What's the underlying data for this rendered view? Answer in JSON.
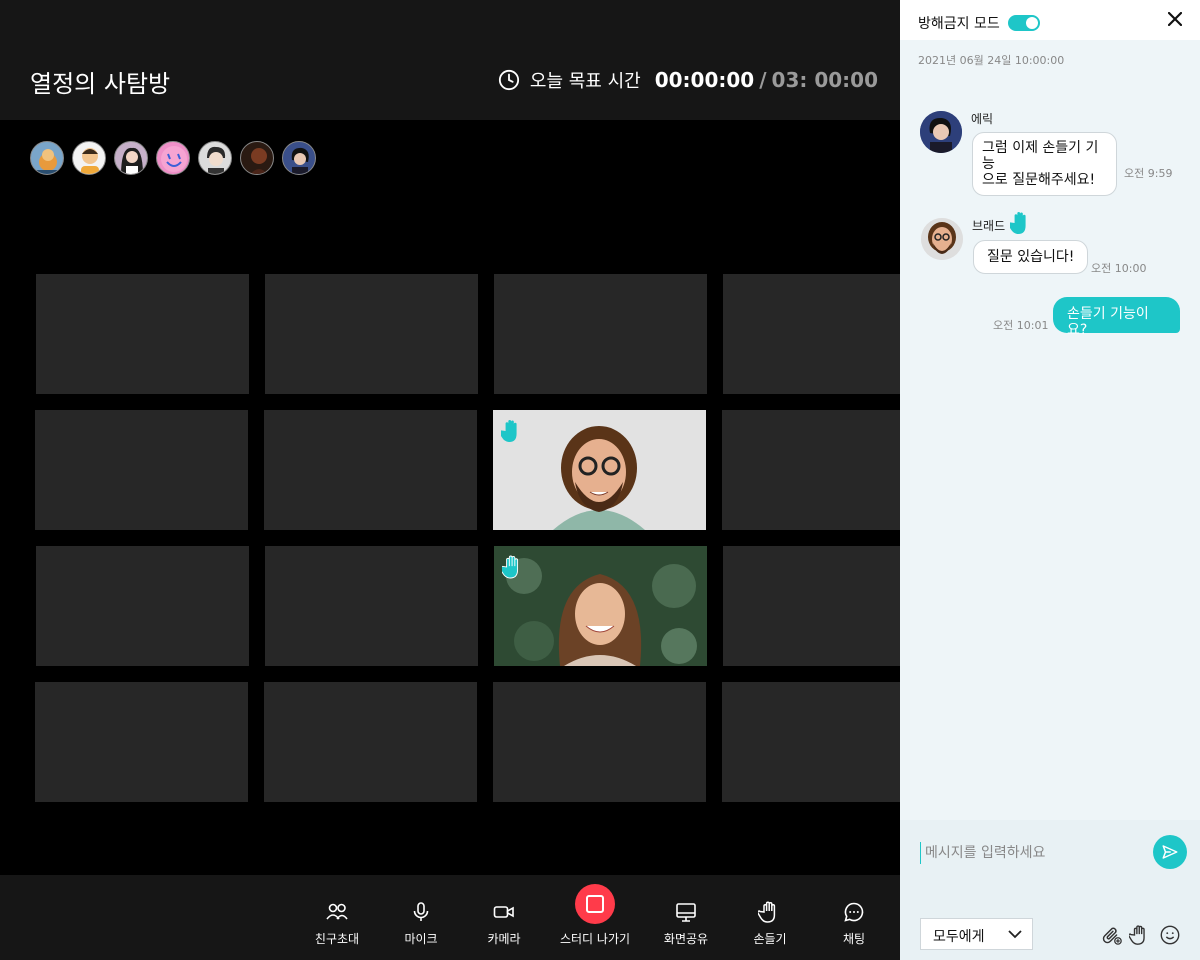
{
  "room": {
    "title": "열정의 사탐방"
  },
  "timer": {
    "label": "오늘 목표 시간",
    "current": "00:00:00",
    "separator": "/",
    "goal": "03: 00:00"
  },
  "participants": [
    {
      "avatar": "cartoon-cat-avatar",
      "color": "#7aa5c9"
    },
    {
      "avatar": "kid-avatar",
      "color": "#e9b24a"
    },
    {
      "avatar": "woman-avatar",
      "color": "#c6b0c9"
    },
    {
      "avatar": "smiley-avatar",
      "color": "#ef90c8"
    },
    {
      "avatar": "man-avatar",
      "color": "#bdbdbd"
    },
    {
      "avatar": "dark-portrait-avatar",
      "color": "#5a3a2a"
    },
    {
      "avatar": "eric-avatar",
      "color": "#3a4f8a"
    }
  ],
  "toolbar": {
    "invite": "친구초대",
    "mic": "마이크",
    "camera": "카메라",
    "leave": "스터디 나가기",
    "share": "화면공유",
    "raise_hand": "손들기",
    "chat": "채팅"
  },
  "chat": {
    "dnd_label": "방해금지 모드",
    "dnd_on": true,
    "date": "2021년 06월 24일 10:00:00",
    "messages": [
      {
        "sender": "에릭",
        "text": "그럼 이제 손들기 기능\n으로 질문해주세요!",
        "time": "오전 9:59"
      },
      {
        "sender": "브래드",
        "text": "질문 있습니다!",
        "time": "오전 10:00",
        "hand_raised": true
      },
      {
        "mine": true,
        "text": "손들기 기능이요?",
        "time": "오전 10:01"
      }
    ],
    "input_placeholder": "메시지를 입력하세요",
    "recipient": "모두에게"
  },
  "colors": {
    "accent": "#1ec6c8",
    "leave": "#ff3b4a",
    "tile": "#272727"
  }
}
